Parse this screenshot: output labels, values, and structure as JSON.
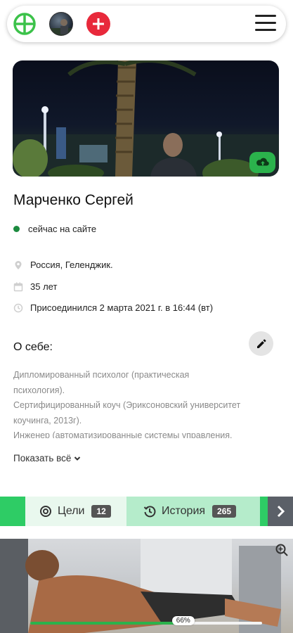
{
  "profile": {
    "name": "Марченко Сергей",
    "status": "сейчас на сайте",
    "location": "Россия, Геленджик.",
    "age": "35 лет",
    "joined": "Присоединился 2 марта 2021 г. в 16:44 (вт)"
  },
  "about": {
    "title": "О себе:",
    "lines": [
      "Дипломированный психолог (практическая",
      "психология).",
      "Сертифицированный коуч (Эриксоновский университет",
      "коучинга, 2013г).",
      "Инженер (автоматизированные системы управления,"
    ],
    "show_all": "Показать всё"
  },
  "tabs": {
    "goals_label": "Цели",
    "goals_count": "12",
    "history_label": "История",
    "history_count": "265"
  },
  "media": {
    "progress_percent": 66,
    "progress_label": "66%"
  },
  "icons": {
    "topbar": [
      "globe-icon",
      "avatar",
      "plus-icon",
      "menu-icon"
    ],
    "hero": "cloud-upload-icon",
    "edit": "pencil-icon"
  },
  "colors": {
    "accent_green": "#2bb24c",
    "online_dot": "#1c8a3f",
    "plus_red": "#e8293b",
    "tab_strip": "#2ecc65"
  }
}
